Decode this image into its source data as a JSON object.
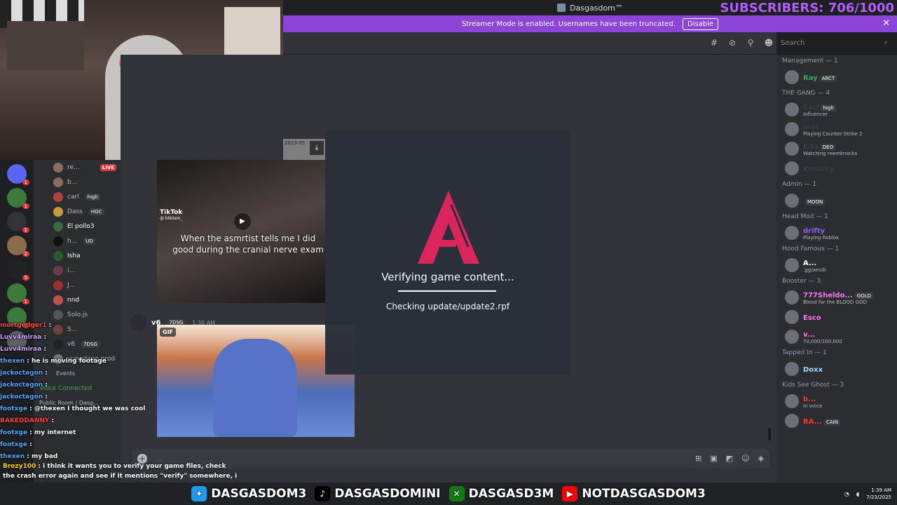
{
  "window": {
    "title": "Dasgasdom™"
  },
  "overlay": {
    "subscribers": "SUBSCRIBERS: 706/1000"
  },
  "banner": {
    "text": "Streamer Mode is enabled. Usernames have been truncated.",
    "button": "Disable"
  },
  "search": {
    "placeholder": "Search"
  },
  "channels": [
    {
      "name": "re...",
      "badge": "LIVE"
    },
    {
      "name": "b..."
    },
    {
      "name": "carl",
      "tag": "high"
    },
    {
      "name": "Dass",
      "tag": "HOC"
    },
    {
      "name": "El pollo3"
    },
    {
      "name": "h...",
      "tag": "UD"
    },
    {
      "name": "Isha"
    },
    {
      "name": "i..."
    },
    {
      "name": "J..."
    },
    {
      "name": "nnd"
    },
    {
      "name": "Solo.js"
    },
    {
      "name": "S..."
    },
    {
      "name": "v6",
      "tag": "7DSG"
    },
    {
      "name": "vungdapo.prod"
    }
  ],
  "voice": {
    "events": "Events",
    "status": "Voice Connected",
    "room": "Public Room / Dasg..."
  },
  "tiktok": {
    "logo": "TikTok",
    "handle": "@ bibiism_",
    "caption": "When the asmrtist tells me I did good during the cranial nerve exam",
    "stamp": "2023-05"
  },
  "message": {
    "user": "v6",
    "tag": "7DSG",
    "time": "1:30 AM",
    "gif_label": "GIF"
  },
  "modal": {
    "title": "Verifying game content...",
    "subtitle": "Checking update/update2.rpf"
  },
  "members": [
    {
      "group": "Management — 1",
      "users": [
        {
          "name": "Ray",
          "tag": "ARCT",
          "color": "#3ba55d"
        }
      ]
    },
    {
      "group": "THE GANG — 4",
      "users": [
        {
          "name": "Carl",
          "tag": "high",
          "sub": "Influencer",
          "color": "#3a3c42"
        },
        {
          "name": "jedc",
          "sub": "Playing Counter-Strike 2",
          "color": "#3a3c42"
        },
        {
          "name": "Kdo",
          "tag": "DEO",
          "sub": "Watching reemknocks",
          "color": "#3a3c42"
        },
        {
          "name": "Kenicky",
          "color": "#3a3c42"
        }
      ]
    },
    {
      "group": "Admin — 1",
      "users": [
        {
          "name": "",
          "tag": "MOON",
          "color": "#3a3c42"
        }
      ]
    },
    {
      "group": "Head Mod — 1",
      "users": [
        {
          "name": "drifty",
          "sub": "Playing Roblox",
          "color": "#8b5cf6"
        }
      ]
    },
    {
      "group": "Hood Famous — 1",
      "users": [
        {
          "name": "A...",
          "sub": ".gg/aesdr",
          "color": "#ffffff"
        }
      ]
    },
    {
      "group": "Booster — 3",
      "users": [
        {
          "name": "777Sheldo...",
          "tag": "GOLD",
          "sub": "Blood for the BLOOD GOD",
          "color": "#ff73fa"
        },
        {
          "name": "Esco",
          "color": "#ff73fa"
        },
        {
          "name": "v...",
          "sub": "70,000/100,000",
          "color": "#ff73fa"
        }
      ]
    },
    {
      "group": "Tapped In — 1",
      "users": [
        {
          "name": "Doxx",
          "color": "#9fd8ff"
        }
      ]
    },
    {
      "group": "Kids See Ghost — 3",
      "users": [
        {
          "name": "b...",
          "sub": "In voice",
          "color": "#ff3030"
        },
        {
          "name": "BA...",
          "tag": "CAIN",
          "color": "#ff3030"
        }
      ]
    }
  ],
  "chat": [
    {
      "user": "mortgedger1",
      "text": ""
    },
    {
      "user": "Luvv4miraa",
      "text": ""
    },
    {
      "user": "Luvv4miraa",
      "text": ""
    },
    {
      "user": "thexen",
      "text": "he is moving footage"
    },
    {
      "user": "jackoctagon",
      "text": ""
    },
    {
      "user": "jackoctagon",
      "text": ""
    },
    {
      "user": "jackoctagon",
      "text": ""
    },
    {
      "user": "footxge",
      "text": "@thexen I thought we was cool"
    },
    {
      "user": "BAKEDDANNY",
      "text": ""
    },
    {
      "user": "footxge",
      "text": "my internet"
    },
    {
      "user": "footxge",
      "text": ""
    },
    {
      "user": "thexen",
      "text": "my bad"
    }
  ],
  "long_message": {
    "user": "Brezy100",
    "text": "i think it wants you to verify your game files, check the crash error again and see if it mentions \"verify\" somewhere, i think its trying to find some update files and it cant"
  },
  "footer": {
    "twitter": "DASGASDOM3",
    "tiktok": "DASGASDOMINI",
    "xbox": "DASGASD3M",
    "youtube": "NOTDASGASDOM3",
    "time": "1:39 AM",
    "date": "7/23/2025"
  }
}
